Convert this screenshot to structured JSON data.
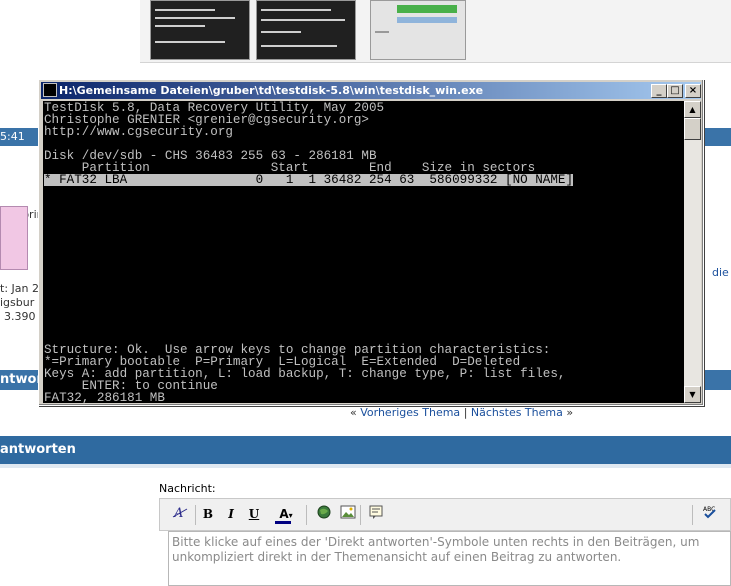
{
  "window": {
    "title": "H:\\Gemeinsame Dateien\\gruber\\td\\testdisk-5.8\\win\\testdisk_win.exe",
    "minimize_label": "_",
    "maximize_label": "□",
    "close_label": "×"
  },
  "console": {
    "lines": [
      "TestDisk 5.8, Data Recovery Utility, May 2005",
      "Christophe GRENIER <grenier@cgsecurity.org>",
      "http://www.cgsecurity.org",
      "",
      "Disk /dev/sdb - CHS 36483 255 63 - 286181 MB",
      "     Partition                Start        End    Size in sectors",
      "* FAT32 LBA                 0   1  1 36482 254 63  586099332 [NO NAME]"
    ],
    "bottom_lines": [
      "Structure: Ok.  Use arrow keys to change partition characteristics:",
      "*=Primary bootable  P=Primary  L=Logical  E=Extended  D=Deleted",
      "Keys A: add partition, L: load backup, T: change type, P: list files,",
      "     ENTER: to continue",
      "FAT32, 286181 MB"
    ],
    "selected_row_index": 6
  },
  "forum": {
    "left_time": "5:41",
    "left_text_1": "aratorin",
    "left_text_2": "t: Jan 2",
    "left_text_3": "igsbur",
    "left_text_4": "3.390",
    "left_button": "ntwort",
    "right_link": "die",
    "nav": {
      "prev_label": "Vorheriges Thema",
      "separator": "|",
      "next_label": "Nächstes Thema",
      "left_quote": "«",
      "right_quote": "»"
    },
    "reply_title": "antworten",
    "message_label": "Nachricht:",
    "editor_placeholder": "Bitte klicke auf eines der 'Direkt antworten'-Symbole unten rechts in den Beiträgen, um unkompliziert direkt in der Themenansicht auf einen Beitrag zu antworten.",
    "toolbar": {
      "bold": "B",
      "italic": "I",
      "underline": "U",
      "font_color": "A"
    }
  },
  "icons": [
    "console-icon",
    "minimize-icon",
    "maximize-icon",
    "close-icon",
    "scroll-up-icon",
    "scroll-down-icon",
    "font-style-icon",
    "font-color-icon",
    "globe-link-icon",
    "image-icon",
    "quote-icon",
    "spellcheck-icon"
  ],
  "colors": {
    "title_bar": "#0a246a",
    "console_bg": "#000000",
    "console_fg": "#c0c0c0",
    "forum_blue": "#2f6aa0"
  }
}
